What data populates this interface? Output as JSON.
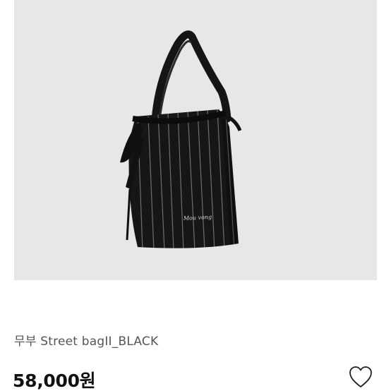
{
  "product": {
    "name": "무부 Street bagII_BLACK",
    "price": "58,000원",
    "image": {
      "background_color": "#e7e7e7",
      "bag_color": "#151515",
      "stripe_color": "#9a9a9a",
      "embroidery_text": "Mou vong"
    },
    "wishlist_icon": "heart-outline-icon",
    "wishlist_active": false
  }
}
